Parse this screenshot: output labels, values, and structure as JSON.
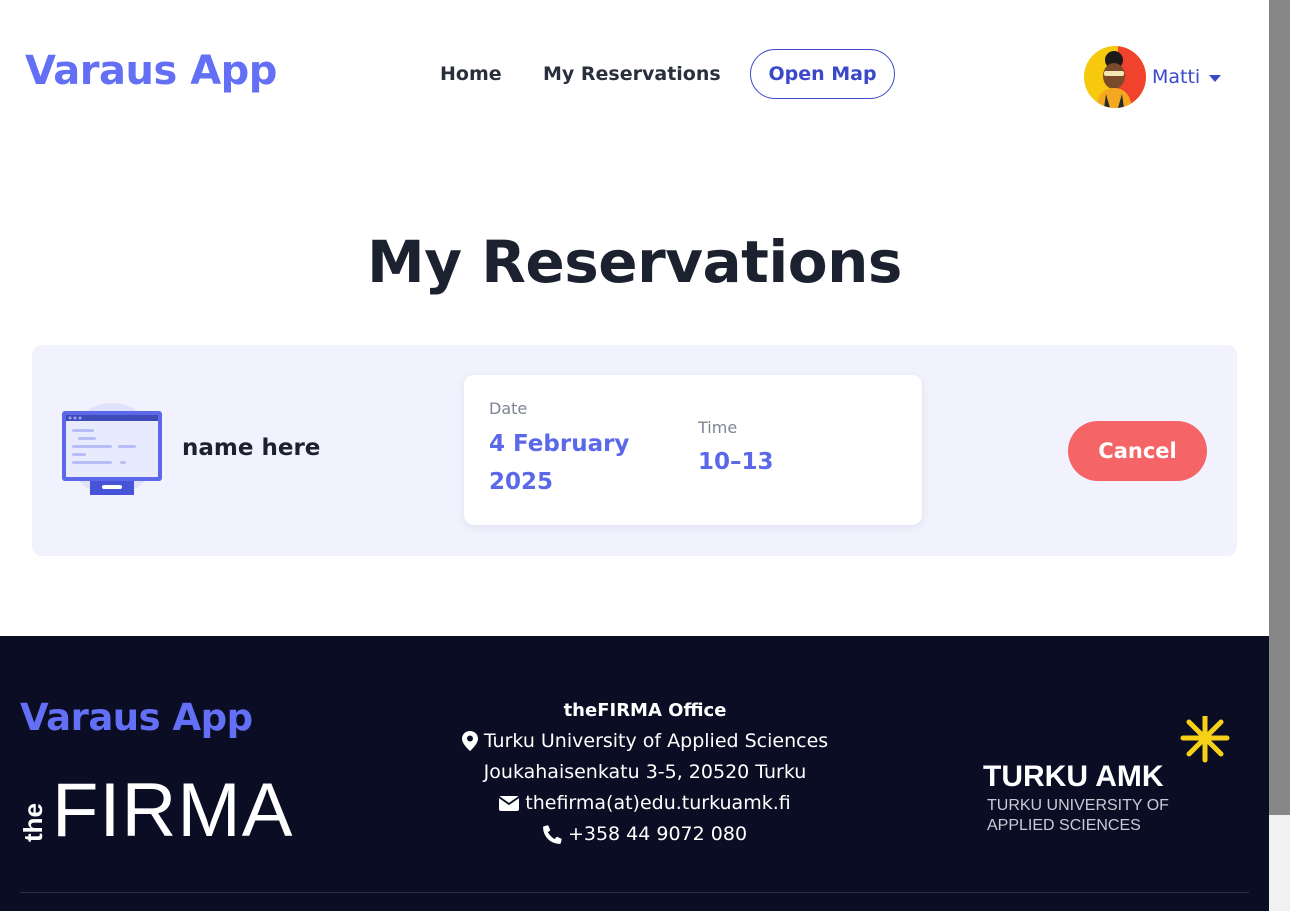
{
  "header": {
    "logo": "Varaus App",
    "nav": {
      "home": "Home",
      "reservations": "My Reservations",
      "open_map": "Open Map"
    },
    "user": {
      "name": "Matti",
      "avatar_icon": "user-avatar"
    }
  },
  "main": {
    "title": "My Reservations",
    "reservations": [
      {
        "name": "name here",
        "icon": "monitor-icon",
        "date_label": "Date",
        "date": "4 February 2025",
        "time_label": "Time",
        "time": "10–13",
        "cancel_label": "Cancel"
      }
    ]
  },
  "footer": {
    "logo": "Varaus App",
    "firma_logo": "theFIRMA",
    "office_title": "theFIRMA Office",
    "address_line1": "Turku University of Applied Sciences",
    "address_line2": "Joukahaisenkatu 3-5, 20520 Turku",
    "email": "thefirma(at)edu.turkuamk.fi",
    "phone": "+358 44 9072 080",
    "partner_logo": {
      "name": "TURKU AMK",
      "line1": "TURKU UNIVERSITY OF",
      "line2": "APPLIED SCIENCES"
    }
  },
  "colors": {
    "accent": "#6370f6",
    "primary_blue": "#3b49c9",
    "cancel": "#f56567",
    "footer_bg": "#0b0d24",
    "card_bg": "#f1f2fd",
    "amk_yellow": "#f7d117"
  }
}
